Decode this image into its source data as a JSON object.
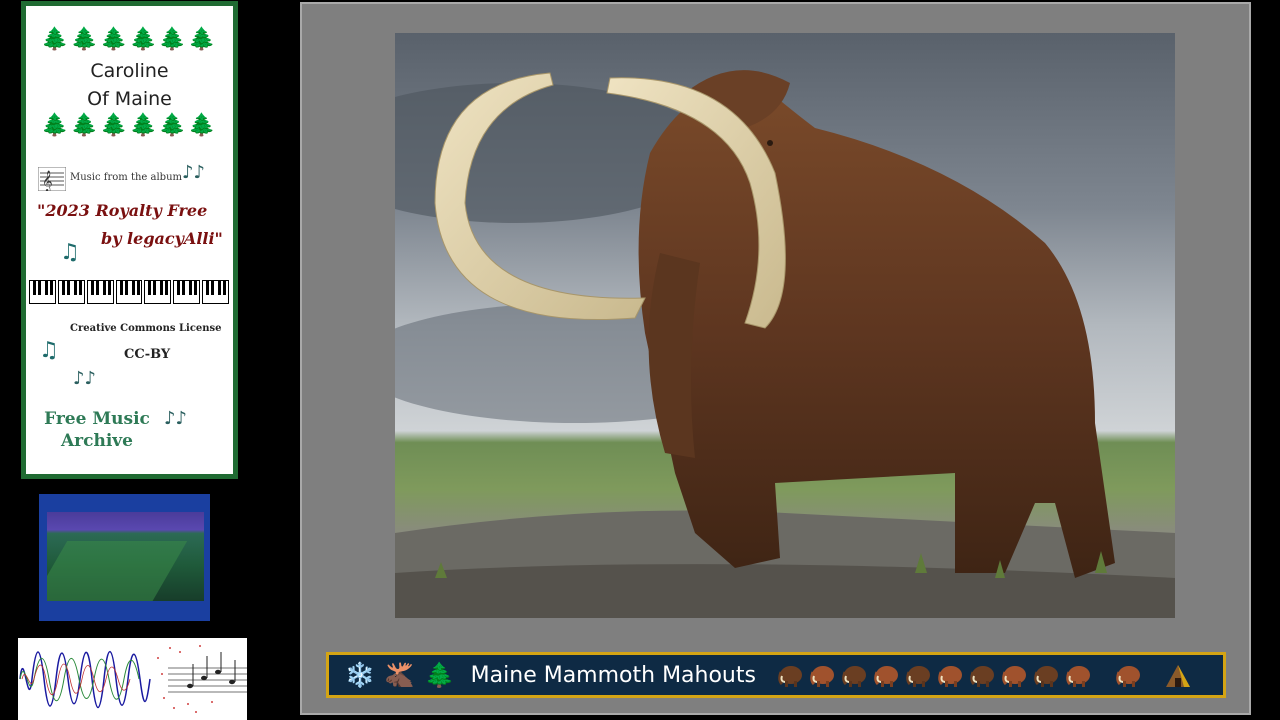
{
  "card": {
    "trees": "🌲🌲🌲🌲🌲🌲",
    "artist_line1": "Caroline",
    "artist_line2": "Of Maine",
    "album_prefix": "Music from the album",
    "album_line1": "\"2023 Royalty Free",
    "album_line2": "by legacyAlli\"",
    "license_label": "Creative Commons License",
    "license_code": "CC-BY",
    "archive_line1": "Free Music",
    "archive_line2": "Archive",
    "note_single": "♫",
    "note_double": "♪♪"
  },
  "banner": {
    "title": "Maine Mammoth Mahouts",
    "snowflake": "❄️",
    "moose": "🫎",
    "tree": "🌲"
  },
  "colors": {
    "card_border": "#1f6b32",
    "album_text": "#7a1010",
    "archive_text": "#2e7a56",
    "banner_bg": "#0e2a44",
    "banner_border": "#d4a414",
    "frame_bg": "#7f7f7f"
  },
  "icons": [
    "tree-icon",
    "music-staff-icon",
    "music-note-icon",
    "piano-keys-icon",
    "snowflake-icon",
    "moose-icon",
    "mammoth-icon",
    "hut-icon"
  ]
}
